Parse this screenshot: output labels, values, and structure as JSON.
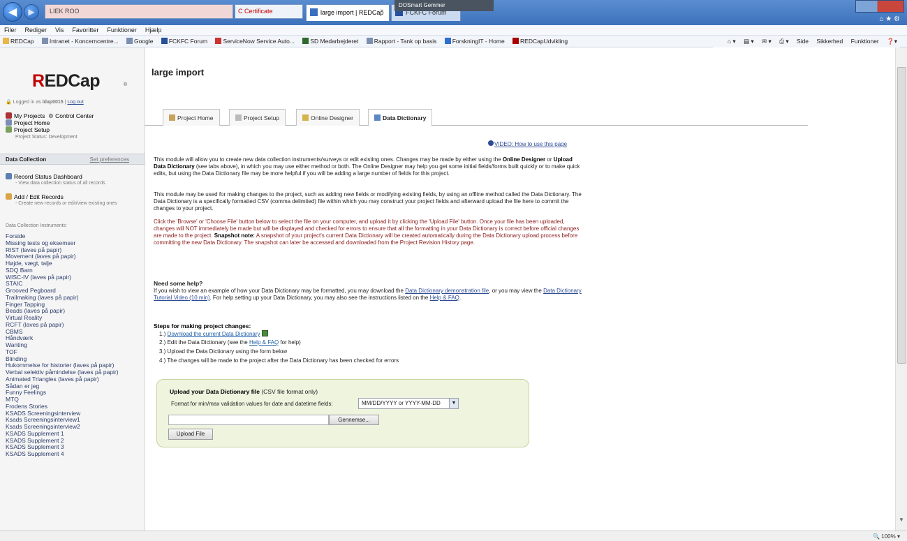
{
  "browser": {
    "address": "LIEK ROO",
    "address_tools": "C Certificate",
    "tabs": [
      {
        "label": "large import | REDCap",
        "active": true
      },
      {
        "label": "FCKFC Forum",
        "active": false
      }
    ],
    "tab_close": "×",
    "taskbar_hint": "DOSmart Gemmer",
    "menu": [
      "Filer",
      "Rediger",
      "Vis",
      "Favoritter",
      "Funktioner",
      "Hjælp"
    ],
    "favorites": [
      "REDCap",
      "Intranet - Koncerncentre...",
      "Google",
      "FCKFC Forum",
      "ServiceNow Service Auto...",
      "SD Medarbejderet",
      "Rapport - Tank op basis",
      "ForskningIT - Home",
      "REDCapUdvikling"
    ],
    "commands": [
      "Side",
      "Sikkerhed",
      "Funktioner"
    ],
    "zoom": "100%"
  },
  "sidebar": {
    "logo_text": "REDCap",
    "logo_r": "R",
    "logo_rest": "EDCap",
    "logo_sup": "®",
    "logged_in": "Logged in as",
    "logout": "Log out",
    "my_projects": "My Projects",
    "control_center": "Control Center",
    "project_home": "Project Home",
    "project_setup": "Project Setup",
    "project_status": "Project Status: Development",
    "data_collection": {
      "title": "Data Collection",
      "right_link": "Set preferences",
      "record_status": "Record Status Dashboard",
      "record_status_sub": "- View data collection status of all records",
      "add_edit": "Add / Edit Records",
      "add_edit_sub": "- Create new records or edit/view existing ones",
      "instruments_label": "Data Collection Instruments:"
    },
    "instruments": [
      "Forside",
      "Missing tests og eksemser",
      "RIST (laves på papir)",
      "Movement (laves på papir)",
      "Højde, vægt, talje",
      "SDQ Barn",
      "WISC-IV (laves på papir)",
      "STAIC",
      "Grooved Pegboard",
      "Trailmaking (laves på papir)",
      "Finger Tapping",
      "Beads (laves på papir)",
      "Virtual Reality",
      "RCFT (laves på papir)",
      "CBMS",
      "Håndværk",
      "Wanting",
      "TOF",
      "Blinding",
      "Hukommelse for historier (laves på papir)",
      "Verbal selektiv påmindelse (laves på papir)",
      "Animated Triangles (laves på papir)",
      "Sådan er jeg",
      "Funny Feelings",
      "MTQ",
      "Frodens Stories",
      "KSADS Screeningsinterview",
      "Ksads Screeningsinterview1",
      "Ksads Screeningsinterview2",
      "KSADS Supplement 1",
      "KSADS Supplement 2",
      "KSADS Supplement 3",
      "KSADS Supplement 4"
    ]
  },
  "main": {
    "title": "large import",
    "tabs": [
      "Project Home",
      "Project Setup",
      "Online Designer",
      "Data Dictionary"
    ],
    "video_link": "VIDEO: How to use this page",
    "para1": {
      "t1": "This module will allow you to create new data collection instruments/surveys or edit existing ones. Changes may be made by either using the ",
      "b1": "Online Designer",
      "t2": " or ",
      "b2": "Upload Data Dictionary",
      "t3": " (see tabs above), in which you may use either method or both. The Online Designer may help you get some initial fields/forms built quickly or to make quick edits, but using the Data Dictionary file may be more helpful if you will be adding a large number of fields for this project."
    },
    "para2": "This module may be used for making changes to the project, such as adding new fields or modifying existing fields, by using an offline method called the Data Dictionary. The Data Dictionary is a specifically formatted CSV (comma delimited) file within which you may construct your project fields and afterward upload the file here to commit the changes to your project.",
    "para3": {
      "t1": "Click the 'Browse' or 'Choose File' button below to select the file on your computer, and upload it by clicking the 'Upload File' button. Once your file has been uploaded, changes will NOT immediately be made but will be displayed and checked for errors to ensure that all the formatting in your Data Dictionary is correct before official changes are made to the project. ",
      "b1": "Snapshot note:",
      "t2": " A snapshot of your project's current Data Dictionary will be created automatically during the Data Dictionary upload process before committing the new Data Dictionary. The snapshot can later be accessed and downloaded from the Project Revision History page."
    },
    "help": {
      "title": "Need some help?",
      "t1": "If you wish to view an example of how your Data Dictionary may be formatted, you may download the ",
      "l1": "Data Dictionary demonstration file",
      "t2": ", or you may view the ",
      "l2": "Data Dictionary Tutorial Video (10 min)",
      "t3": ". For help setting up your Data Dictionary, you may also see the instructions listed on the ",
      "l3": "Help & FAQ",
      "t4": "."
    },
    "steps": {
      "title": "Steps for making project changes:",
      "s1_prefix": "1.) ",
      "s1_link": "Download the current Data Dictionary",
      "s2_prefix": "2.) Edit the Data Dictionary (see the ",
      "s2_link": "Help & FAQ",
      "s2_suffix": " for help)",
      "s3": "3.) Upload the Data Dictionary using the form below",
      "s4": "4.) The changes will be made to the project after the Data Dictionary has been checked for errors"
    },
    "upload": {
      "title_bold": "Upload your Data Dictionary file",
      "title_rest": " (CSV file format only)",
      "format_label": "Format for min/max validation values for date and datetime fields:",
      "format_value": "MM/DD/YYYY or YYYY-MM-DD",
      "browse_label": "Gennemse...",
      "upload_label": "Upload File"
    }
  }
}
